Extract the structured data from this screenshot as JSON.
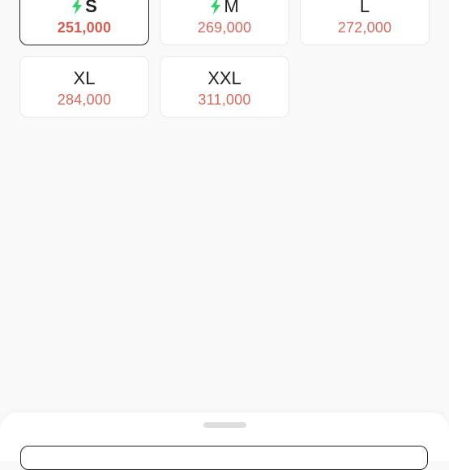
{
  "size_options": [
    {
      "label": "S",
      "price": "251,000",
      "fast_delivery": true,
      "selected": true
    },
    {
      "label": "M",
      "price": "269,000",
      "fast_delivery": true,
      "selected": false
    },
    {
      "label": "L",
      "price": "272,000",
      "fast_delivery": false,
      "selected": false
    },
    {
      "label": "XL",
      "price": "284,000",
      "fast_delivery": false,
      "selected": false
    },
    {
      "label": "XXL",
      "price": "311,000",
      "fast_delivery": false,
      "selected": false
    }
  ],
  "colors": {
    "price_text": "#d76a5d",
    "fast_delivery_icon": "#2fd16b",
    "selected_border": "#222222"
  },
  "icons": {
    "fast_delivery": "lightning-bolt-icon"
  }
}
